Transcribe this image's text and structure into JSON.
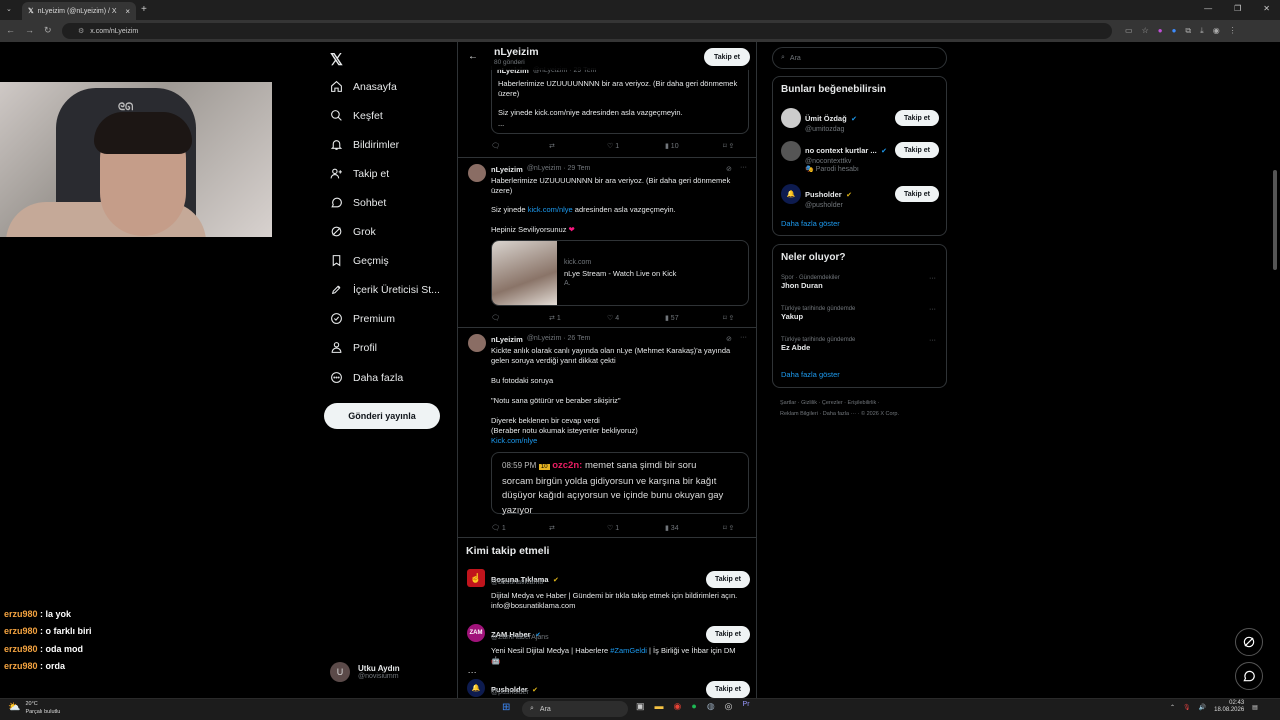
{
  "browser": {
    "tab_title": "nLyeizim (@nLyeizim) / X",
    "url": "x.com/nLyeizim",
    "new_tab": "+",
    "close": "×"
  },
  "chat": [
    {
      "user": "erzu980",
      "message": "la yok"
    },
    {
      "user": "erzu980",
      "message": "o farklı biri"
    },
    {
      "user": "erzu980",
      "message": "oda mod"
    },
    {
      "user": "erzu980",
      "message": "orda"
    }
  ],
  "nav": {
    "items": [
      {
        "label": "Anasayfa",
        "icon": "home-icon"
      },
      {
        "label": "Keşfet",
        "icon": "search-icon"
      },
      {
        "label": "Bildirimler",
        "icon": "bell-icon"
      },
      {
        "label": "Takip et",
        "icon": "person-plus-icon"
      },
      {
        "label": "Sohbet",
        "icon": "chat-icon"
      },
      {
        "label": "Grok",
        "icon": "grok-icon"
      },
      {
        "label": "Geçmiş",
        "icon": "bookmark-icon"
      },
      {
        "label": "İçerik Üreticisi St...",
        "icon": "rocket-icon"
      },
      {
        "label": "Premium",
        "icon": "verified-icon"
      },
      {
        "label": "Profil",
        "icon": "person-icon"
      },
      {
        "label": "Daha fazla",
        "icon": "more-circle-icon"
      }
    ],
    "post_button": "Gönderi yayınla",
    "account": {
      "initial": "U",
      "name": "Utku Aydın",
      "handle": "@novisiumm"
    }
  },
  "profile_header": {
    "name": "nLyeizim",
    "posts": "80 gönderi",
    "follow": "Takip et"
  },
  "tweets": [
    {
      "quoted_name": "nLyeizim",
      "quoted_meta": "@nLyeizim · 29 Tem",
      "line1": "Haberlerimize UZUUUUNNNN bir ara veriyoz. (Bir daha geri dönmemek",
      "line2": "üzere)",
      "line3": "Siz yinede kick.com/niye adresinden asla vazgeçmeyin.",
      "line4": "...",
      "likes": "1",
      "views": "10"
    },
    {
      "name": "nLyeizim",
      "meta": "@nLyeizim · 29 Tem",
      "line1": "Haberlerimize UZUUUUNNNN bir ara veriyoz. (Bir daha geri dönmemek",
      "line2": "üzere)",
      "line3a": "Siz yinede ",
      "line3link": "kick.com/nlye",
      "line3b": " adresinden asla vazgeçmeyin.",
      "line4": "Hepiniz Seviliyorsunuz",
      "card_domain": "kick.com",
      "card_title": "nLye Stream - Watch Live on Kick",
      "card_sub": "A.",
      "reposts": "1",
      "likes": "4",
      "views": "57"
    },
    {
      "name": "nLyeizim",
      "meta": "@nLyeizim · 26 Tem",
      "line1": "Kickte anlık olarak canlı yayında olan nLye (Mehmet Karakaş)'a yayında",
      "line2": "gelen soruya verdiği yanıt dikkat çekti",
      "line3": "Bu fotodaki soruya",
      "line4": "\"Notu sana götürür ve beraber sikişiriz\"",
      "line5": "Diyerek beklenen bir cevap verdi",
      "line6": "(Beraber notu okumak isteyenler bekliyoruz)",
      "link": "Kick.com/nlye",
      "quote_time": "08:59 PM",
      "quote_badge": "10",
      "quote_user": "ozc2n:",
      "quote_text1": "memet sana şimdi bir soru",
      "quote_text2": "sorcam birgün yolda gidiyorsun ve karşına bir kağıt",
      "quote_text3": "düşüyor kağıdı açıyorsun ve içinde bunu okuyan gay",
      "quote_text4": "yazıyor",
      "replies": "1",
      "likes": "1",
      "views": "34"
    }
  ],
  "who_to_follow": {
    "title": "Kimi takip etmeli",
    "items": [
      {
        "name": "Boşuna Tıklama",
        "handle": "@bosunatiklama",
        "bio1": "Dijital Medya ve Haber | Gündemi bir tıkla takip etmek için bildirimleri açın.",
        "bio2": "info@bosunatiklama.com",
        "button": "Takip et"
      },
      {
        "name": "ZAM Haber",
        "handle": "@ZamHaberAjans",
        "bio1a": "Yeni Nesil Dijital Medya | Haberlere ",
        "bio1link": "#ZamGeldi",
        "bio1b": " | İş Birliği ve İhbar için DM",
        "avatar": "ZAM",
        "button": "Takip et"
      },
      {
        "name": "Pusholder",
        "handle": "@pusholder",
        "button": "Takip et"
      }
    ]
  },
  "right": {
    "search_placeholder": "Ara",
    "suggest_title": "Bunları beğenebilirsin",
    "suggestions": [
      {
        "name": "Ümit Özdağ",
        "handle": "@umitozdag",
        "button": "Takip et"
      },
      {
        "name": "no context kurtlar ...",
        "handle": "@nocontexttkv",
        "note": "Parodi hesabı",
        "button": "Takip et"
      },
      {
        "name": "Pusholder",
        "handle": "@pusholder",
        "button": "Takip et"
      }
    ],
    "show_more": "Daha fazla göster",
    "trends_title": "Neler oluyor?",
    "trends": [
      {
        "category": "Spor · Gündemdekiler",
        "name": "Jhon Duran"
      },
      {
        "category": "Türkiye tarihinde gündemde",
        "name": "Yakup"
      },
      {
        "category": "Türkiye tarihinde gündemde",
        "name": "Ez Abde"
      }
    ],
    "trends_more": "Daha fazla göster",
    "footer_line1": "Şartlar  ·  Gizlilik  ·  Çerezler  ·  Erişilebilirlik  ·",
    "footer_line2": "Reklam Bilgileri  ·  Daha fazla ···  ·  © 2026 X Corp."
  },
  "taskbar": {
    "temp": "20°C",
    "weather": "Parçalı bulutlu",
    "search": "Ara",
    "time": "02:43",
    "date": "18.08.2026"
  },
  "colors": {
    "accent": "#1d9bf0",
    "chat_user": "#f4a340",
    "quote_user": "#e91e63",
    "like_heart": "#f91880"
  }
}
